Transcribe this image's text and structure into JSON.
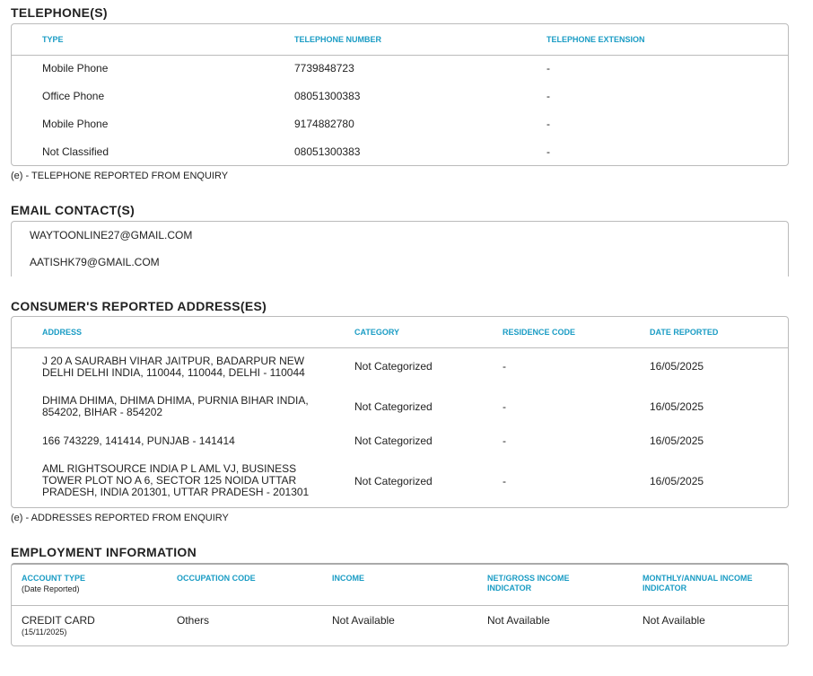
{
  "telephones": {
    "title": "TELEPHONE(S)",
    "headers": [
      "TYPE",
      "TELEPHONE NUMBER",
      "TELEPHONE EXTENSION"
    ],
    "rows": [
      [
        "Mobile Phone",
        "7739848723",
        "-"
      ],
      [
        "Office Phone",
        "08051300383",
        "-"
      ],
      [
        "Mobile Phone",
        "9174882780",
        "-"
      ],
      [
        "Not Classified",
        "08051300383",
        "-"
      ]
    ],
    "note": "(e) - TELEPHONE REPORTED FROM ENQUIRY"
  },
  "emails": {
    "title": "EMAIL CONTACT(S)",
    "items": [
      "WAYTOONLINE27@GMAIL.COM",
      "AATISHK79@GMAIL.COM"
    ]
  },
  "addresses": {
    "title": "CONSUMER'S REPORTED ADDRESS(ES)",
    "headers": [
      "ADDRESS",
      "CATEGORY",
      "RESIDENCE CODE",
      "DATE REPORTED"
    ],
    "rows": [
      [
        "J 20 A SAURABH VIHAR JAITPUR, BADARPUR NEW DELHI DELHI INDIA, 110044, 110044, DELHI - 110044",
        "Not Categorized",
        "-",
        "16/05/2025"
      ],
      [
        "DHIMA DHIMA, DHIMA DHIMA, PURNIA BIHAR INDIA, 854202, BIHAR - 854202",
        "Not Categorized",
        "-",
        "16/05/2025"
      ],
      [
        "166 743229, 141414, PUNJAB - 141414",
        "Not Categorized",
        "-",
        "16/05/2025"
      ],
      [
        "AML RIGHTSOURCE INDIA P L AML VJ, BUSINESS TOWER PLOT NO A 6, SECTOR 125 NOIDA UTTAR PRADESH, INDIA 201301, UTTAR PRADESH - 201301",
        "Not Categorized",
        "-",
        "16/05/2025"
      ]
    ],
    "note": "(e) - ADDRESSES REPORTED FROM ENQUIRY"
  },
  "employment": {
    "title": "EMPLOYMENT INFORMATION",
    "headers": [
      "ACCOUNT TYPE",
      "OCCUPATION CODE",
      "INCOME",
      "NET/GROSS INCOME INDICATOR",
      "MONTHLY/ANNUAL INCOME INDICATOR"
    ],
    "header_sub": "(Date Reported)",
    "row": {
      "account_type": "CREDIT CARD",
      "date": "(15/11/2025)",
      "occupation": "Others",
      "income": "Not Available",
      "net_gross": "Not Available",
      "monthly_annual": "Not Available"
    }
  }
}
